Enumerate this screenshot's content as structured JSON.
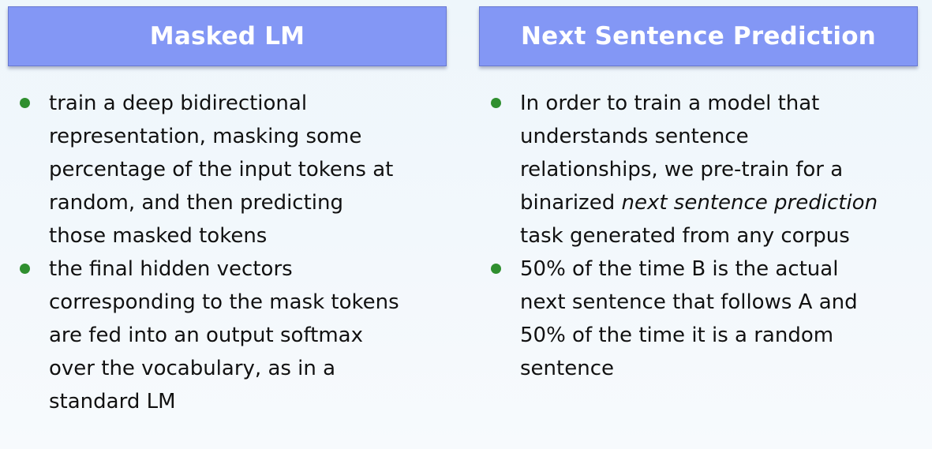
{
  "left": {
    "title": "Masked LM",
    "bullets": [
      {
        "lines": [
          "train a deep bidirectional",
          "representation, masking some",
          "percentage of the input tokens at",
          "random, and then predicting",
          "those masked tokens"
        ]
      },
      {
        "lines": [
          "the final hidden vectors",
          "corresponding to the mask tokens",
          "are fed into an output softmax",
          "over the vocabulary, as in a",
          "standard LM"
        ]
      }
    ]
  },
  "right": {
    "title": "Next Sentence Prediction",
    "bullets": [
      {
        "lines": [
          "In order to train a model that",
          "understands sentence",
          "relationships, we pre-train for a"
        ],
        "line4_prefix": "binarized ",
        "line4_italic": "next sentence prediction",
        "line5": "task generated from any corpus"
      },
      {
        "lines": [
          "50% of the time B is the actual",
          "next sentence that follows A and",
          "50% of the time it is a random",
          "sentence"
        ]
      }
    ]
  },
  "colors": {
    "header_fill": "#8397f5",
    "bullet": "#2f8f2f",
    "background": "#eef6fb"
  }
}
